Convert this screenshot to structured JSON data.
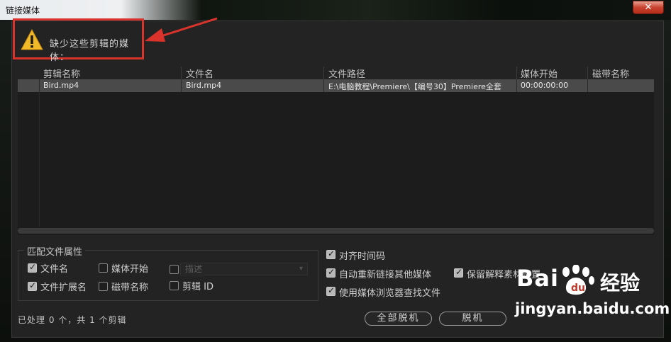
{
  "window": {
    "title": "链接媒体",
    "close_label": "✕"
  },
  "warning": {
    "icon": "warning-icon",
    "message": "缺少这些剪辑的媒体："
  },
  "table": {
    "columns": [
      "剪辑名称",
      "文件名",
      "文件路径",
      "媒体开始",
      "磁带名称"
    ],
    "rows": [
      {
        "clip_name": "Bird.mp4",
        "file_name": "Bird.mp4",
        "file_path": "E:\\电脑教程\\Premiere\\【编号30】Premiere全套",
        "media_start": "00:00:00:00",
        "tape_name": ""
      }
    ]
  },
  "match_group": {
    "title": "匹配文件属性",
    "options": [
      {
        "label": "文件名",
        "checked": true
      },
      {
        "label": "媒体开始",
        "checked": false
      },
      {
        "label": "",
        "checked": false
      },
      {
        "label": "文件扩展名",
        "checked": true
      },
      {
        "label": "磁带名称",
        "checked": false
      },
      {
        "label": "剪辑 ID",
        "checked": false
      }
    ],
    "description_placeholder": "描述"
  },
  "right_options": [
    {
      "label": "对齐时间码",
      "checked": true
    },
    {
      "label": "自动重新链接其他媒体",
      "checked": true
    },
    {
      "label": "保留解释素材设置",
      "checked": true
    },
    {
      "label": "使用媒体浏览器查找文件",
      "checked": true
    }
  ],
  "status": "已处理 0 个，共 1 个剪辑",
  "buttons": {
    "offline_all": "全部脱机",
    "offline": "脱机"
  },
  "watermark": {
    "brand": "Bai",
    "brand_suffix": "经验",
    "url": "jingyan.baidu.com"
  },
  "colors": {
    "highlight_red": "#d9332b",
    "row_selected": "#4a4a4a",
    "dialog_bg": "#232323"
  }
}
